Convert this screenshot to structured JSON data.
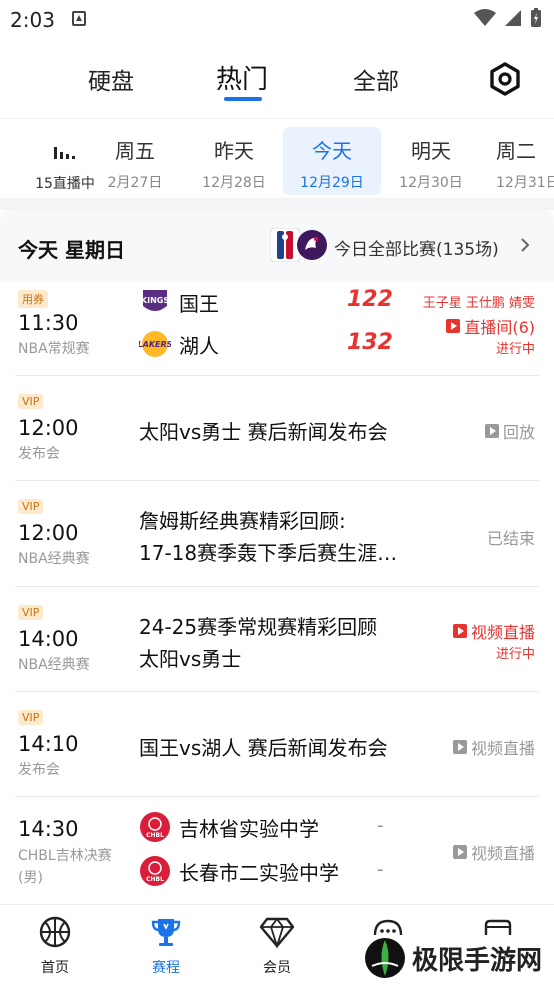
{
  "status_bar": {
    "time": "2:03"
  },
  "top_tabs": [
    "硬盘",
    "热门",
    "全部"
  ],
  "date_strip": {
    "live_label": "15直播中",
    "days": [
      {
        "name": "周五",
        "date": "2月27日"
      },
      {
        "name": "昨天",
        "date": "12月28日"
      },
      {
        "name": "今天",
        "date": "12月29日"
      },
      {
        "name": "明天",
        "date": "12月30日"
      },
      {
        "name": "周二",
        "date": "12月31日"
      }
    ]
  },
  "day_header": {
    "title": "今天 星期日",
    "all_matches": "今日全部比赛(135场)"
  },
  "matches": [
    {
      "badge": "用券",
      "time": "11:30",
      "category": "NBA常规赛",
      "home": {
        "name": "国王",
        "score": "122"
      },
      "away": {
        "name": "湖人",
        "score": "132"
      },
      "commentators": "王子星 王仕鹏 婧雯",
      "live_room": "直播间(6)",
      "progress": "进行中"
    },
    {
      "badge": "VIP",
      "time": "12:00",
      "category": "发布会",
      "title": [
        "太阳vs勇士 赛后新闻发布会"
      ],
      "status": "回放"
    },
    {
      "badge": "VIP",
      "time": "12:00",
      "category": "NBA经典赛",
      "title": [
        "詹姆斯经典赛精彩回顾:",
        "17-18赛季轰下季后赛生涯…"
      ],
      "status": "已结束"
    },
    {
      "badge": "VIP",
      "time": "14:00",
      "category": "NBA经典赛",
      "title": [
        "24-25赛季常规赛精彩回顾",
        "太阳vs勇士"
      ],
      "status": "视频直播",
      "progress": "进行中"
    },
    {
      "badge": "VIP",
      "time": "14:10",
      "category": "发布会",
      "title": [
        "国王vs湖人 赛后新闻发布会"
      ],
      "status": "视频直播"
    },
    {
      "time": "14:30",
      "category": [
        "CHBL吉林决赛",
        "(男)"
      ],
      "home": {
        "name": "吉林省实验中学",
        "score": "-"
      },
      "away": {
        "name": "长春市二实验中学",
        "score": "-"
      },
      "status": "视频直播"
    }
  ],
  "bottom_nav": [
    "首页",
    "赛程",
    "会员"
  ],
  "watermark": "极限手游网",
  "colors": {
    "accent": "#1a73e8",
    "live_red": "#e8332f",
    "vip_bg": "#fde9cb",
    "vip_text": "#c4751c"
  }
}
